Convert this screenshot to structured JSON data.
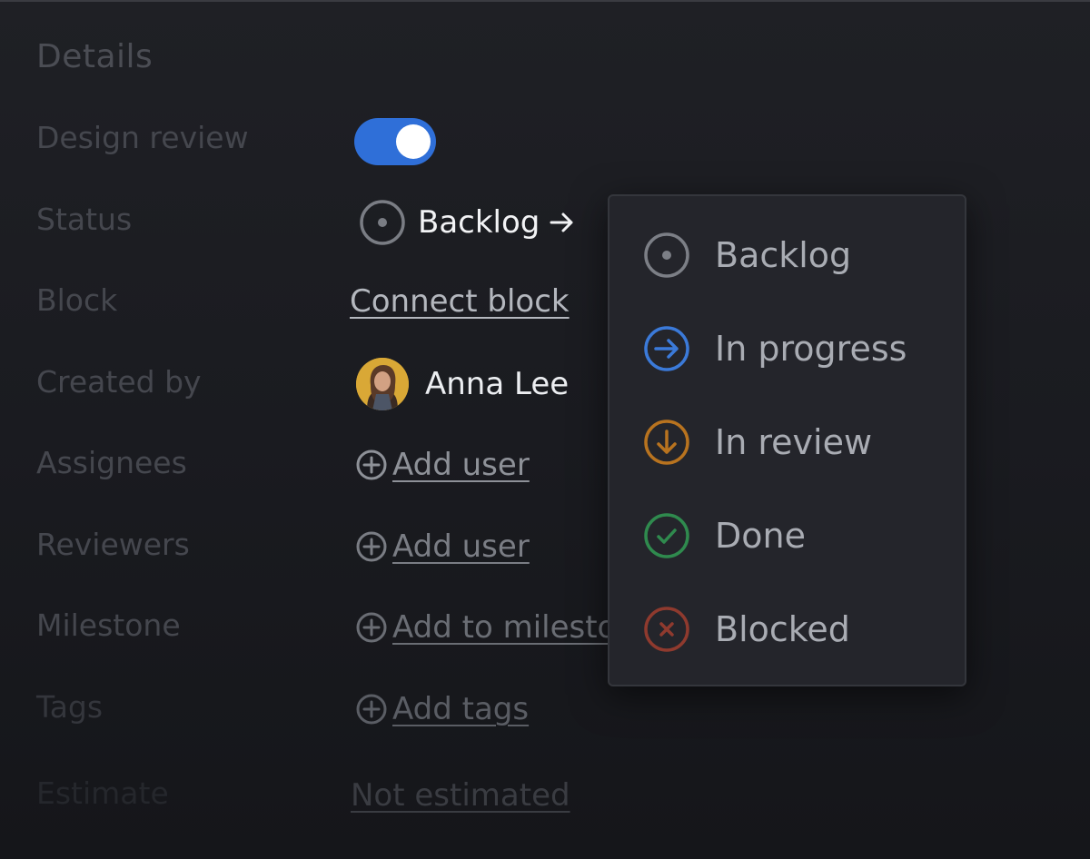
{
  "panel": {
    "title": "Details"
  },
  "rows": {
    "design_review_label": "Design review",
    "status_label": "Status",
    "block_label": "Block",
    "created_by_label": "Created by",
    "assignees_label": "Assignees",
    "reviewers_label": "Reviewers",
    "milestone_label": "Milestone",
    "tags_label": "Tags",
    "estimate_label": "Estimate"
  },
  "design_review": {
    "enabled": true,
    "accent": "#2f6fd8"
  },
  "status": {
    "current": "Backlog"
  },
  "block": {
    "link": "Connect block"
  },
  "created_by": {
    "name": "Anna Lee"
  },
  "assignees": {
    "link": "Add user"
  },
  "reviewers": {
    "link": "Add user"
  },
  "milestone": {
    "link": "Add to milestone"
  },
  "tags": {
    "link": "Add tags"
  },
  "estimate": {
    "link": "Not estimated"
  },
  "status_menu": {
    "items": [
      {
        "label": "Backlog",
        "icon": "backlog-dot-circle-icon",
        "color": "#7c7f86"
      },
      {
        "label": "In progress",
        "icon": "arrow-right-circle-icon",
        "color": "#3b7ad9"
      },
      {
        "label": "In review",
        "icon": "arrow-down-circle-icon",
        "color": "#b8731f"
      },
      {
        "label": "Done",
        "icon": "check-circle-icon",
        "color": "#2f8a4e"
      },
      {
        "label": "Blocked",
        "icon": "x-circle-icon",
        "color": "#8f3a2e"
      }
    ]
  }
}
